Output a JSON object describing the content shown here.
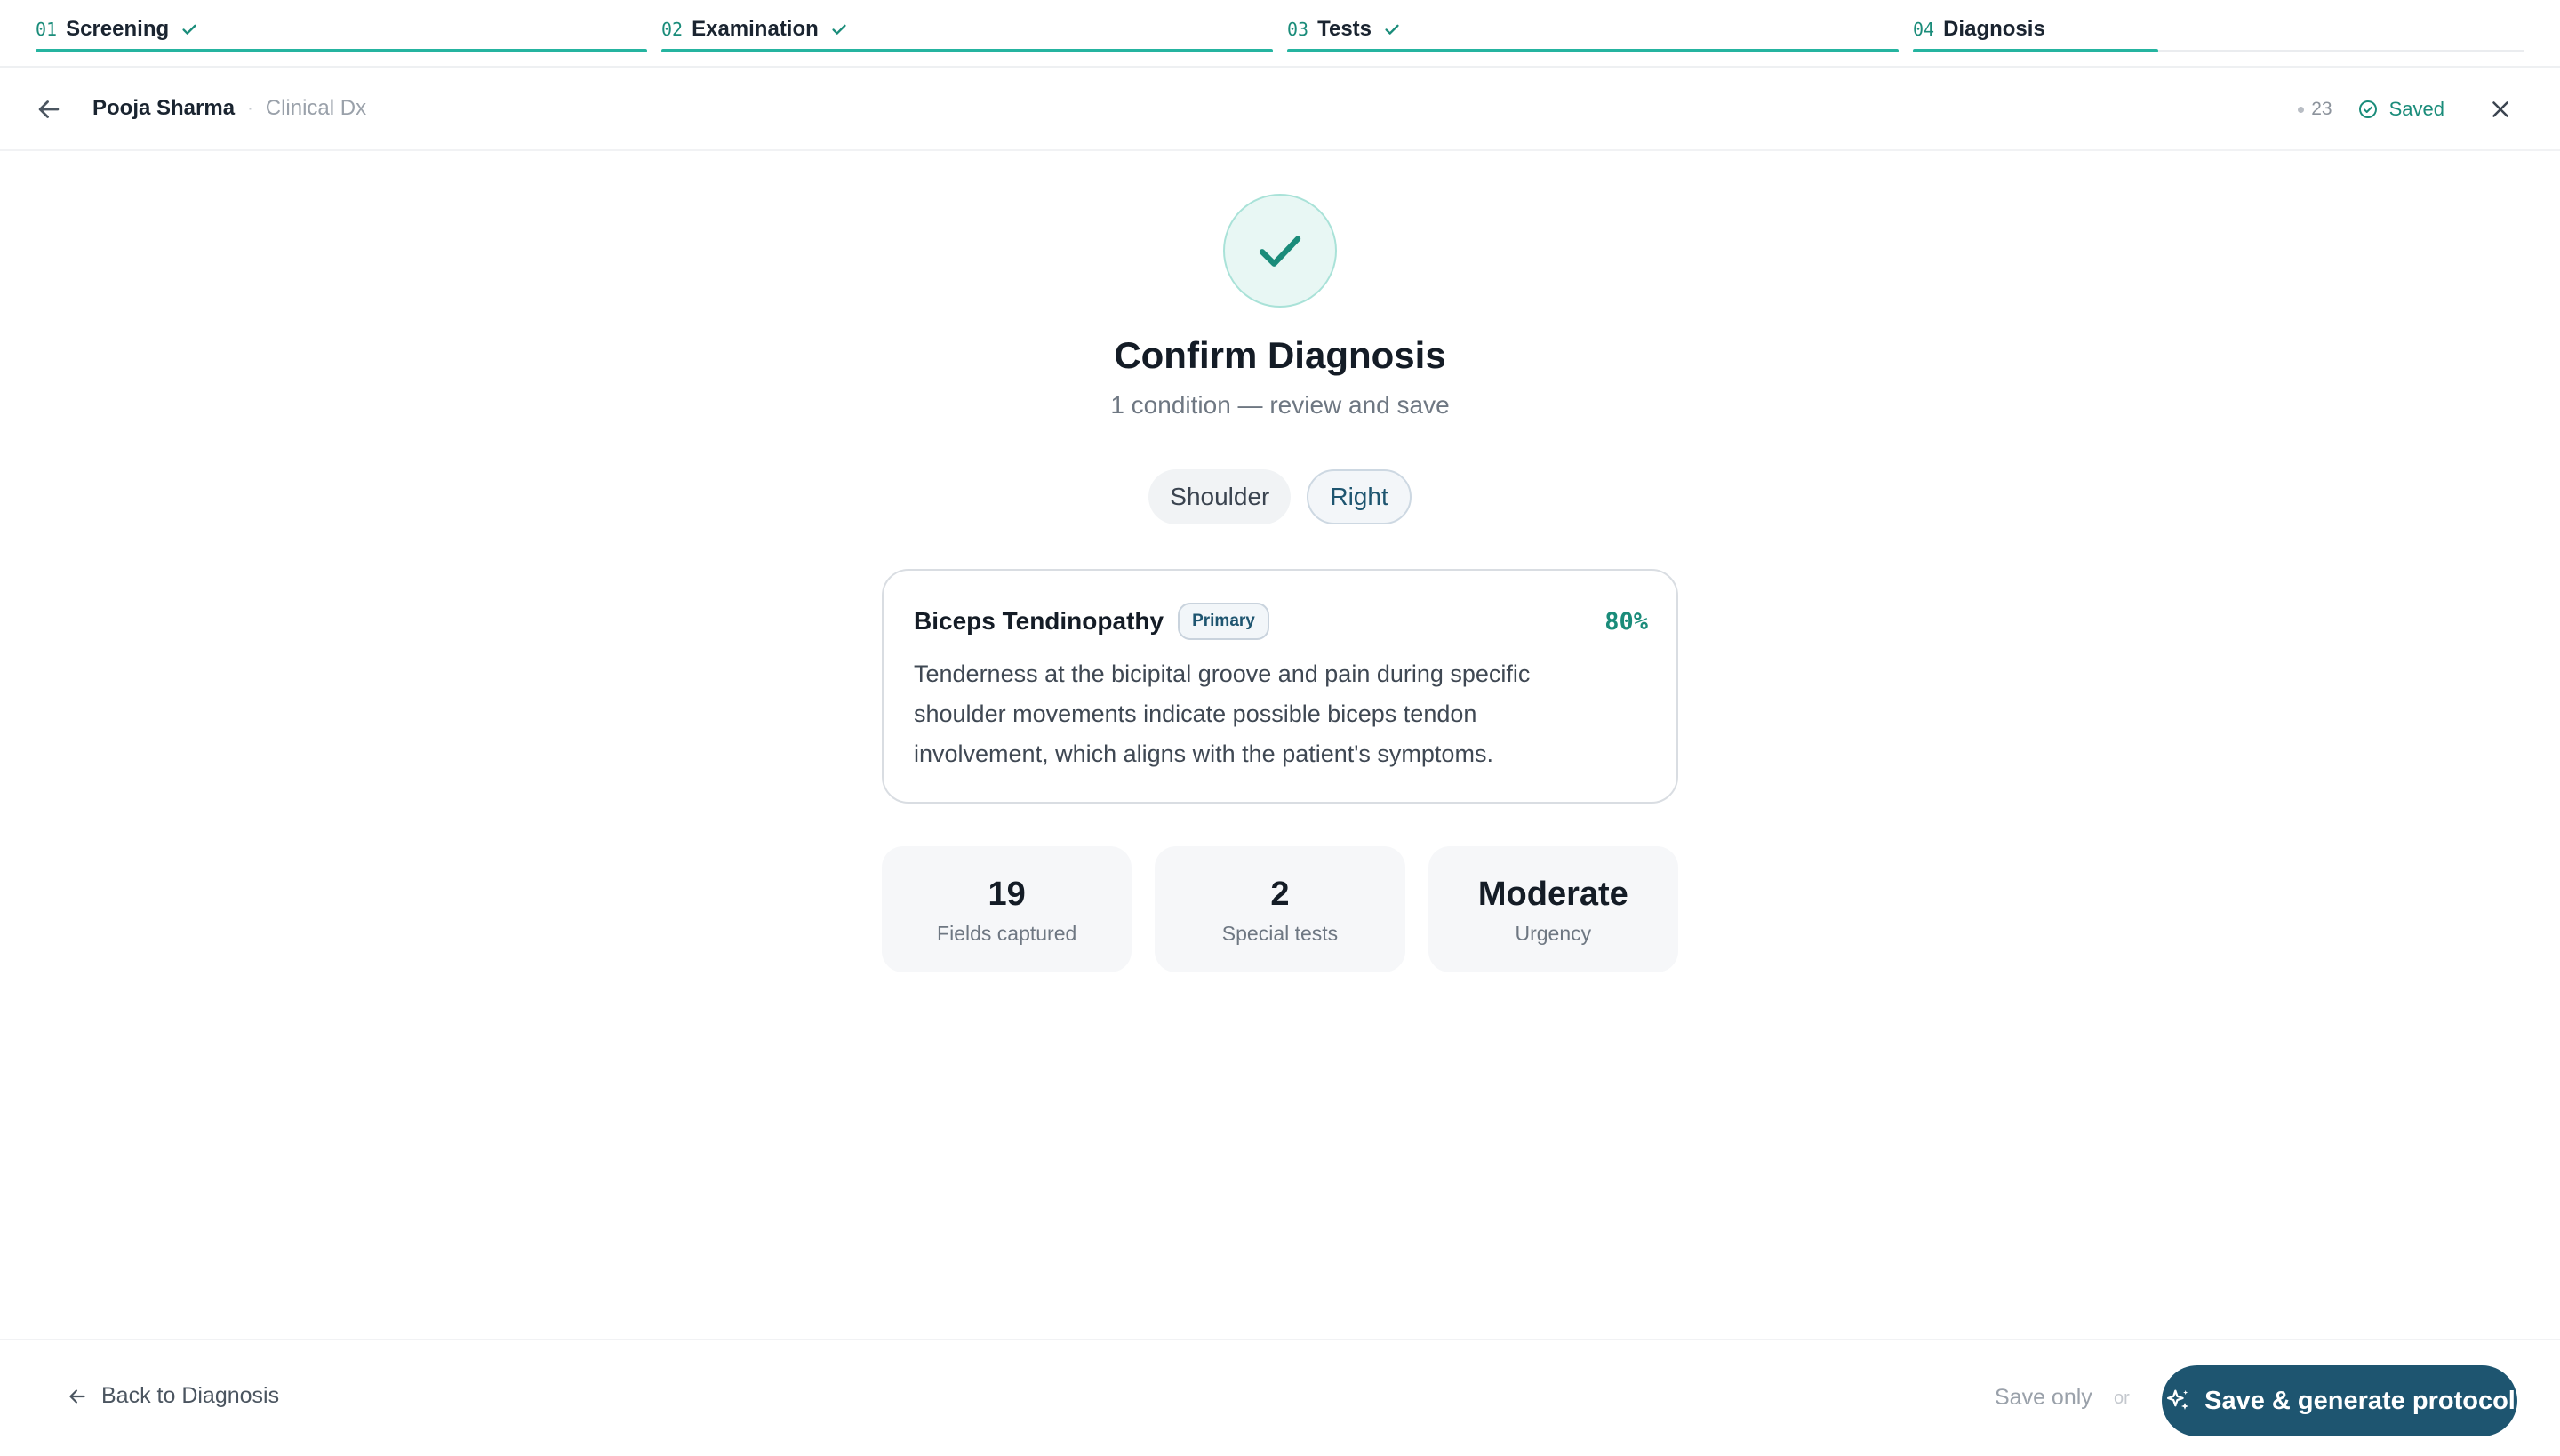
{
  "stepper": {
    "steps": [
      {
        "num": "01",
        "label": "Screening",
        "done": true
      },
      {
        "num": "02",
        "label": "Examination",
        "done": true
      },
      {
        "num": "03",
        "label": "Tests",
        "done": true
      },
      {
        "num": "04",
        "label": "Diagnosis",
        "done": false
      }
    ]
  },
  "header": {
    "patient_name": "Pooja Sharma",
    "separator": "·",
    "context": "Clinical Dx",
    "count": "23",
    "saved_label": "Saved"
  },
  "main": {
    "title": "Confirm Diagnosis",
    "subtitle": "1 condition — review and save",
    "chips": {
      "region": "Shoulder",
      "side": "Right"
    },
    "diagnosis": {
      "name": "Biceps Tendinopathy",
      "badge": "Primary",
      "confidence": "80%",
      "description": "Tenderness at the bicipital groove and pain during specific shoulder movements indicate possible biceps tendon involvement, which aligns with the patient's symptoms."
    },
    "stats": [
      {
        "value": "19",
        "label": "Fields captured"
      },
      {
        "value": "2",
        "label": "Special tests"
      },
      {
        "value": "Moderate",
        "label": "Urgency"
      }
    ]
  },
  "footer": {
    "back_label": "Back to Diagnosis",
    "save_only_label": "Save only",
    "or_label": "or",
    "primary_label": "Save & generate protocol"
  },
  "colors": {
    "accent_teal": "#25b4a0",
    "text_teal": "#1a8c7a",
    "primary_navy": "#1e5570",
    "hero_bg": "#e8f7f4"
  }
}
